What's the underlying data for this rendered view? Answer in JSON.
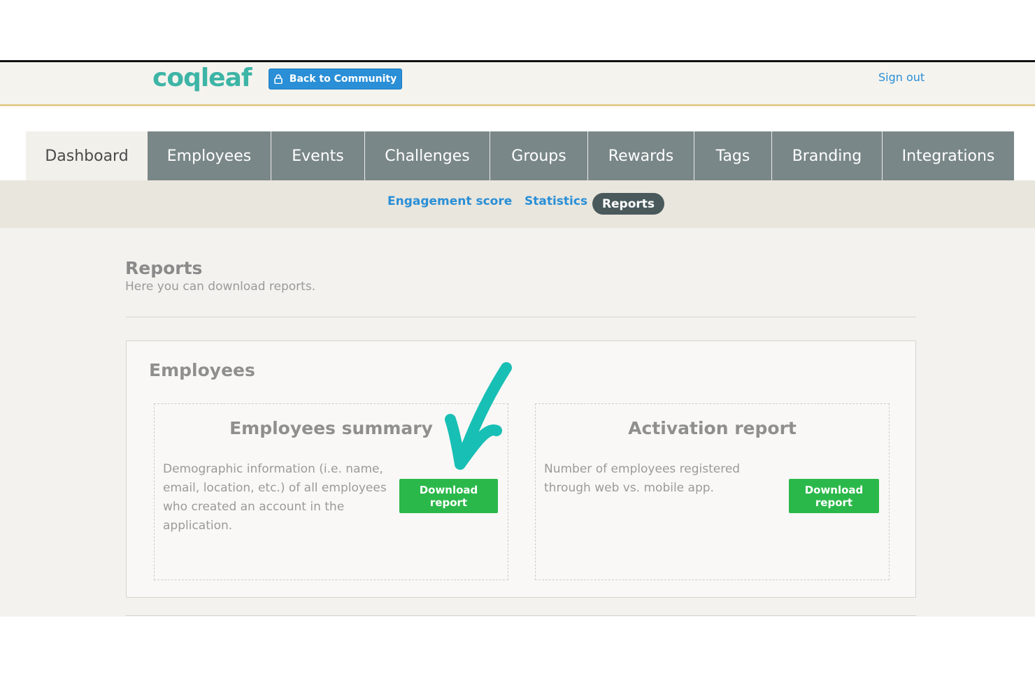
{
  "header": {
    "logo": "coqleaf",
    "back_button": "Back to Community",
    "sign_out": "Sign out"
  },
  "tabs": [
    {
      "label": "Dashboard",
      "active": true
    },
    {
      "label": "Employees"
    },
    {
      "label": "Events"
    },
    {
      "label": "Challenges"
    },
    {
      "label": "Groups"
    },
    {
      "label": "Rewards"
    },
    {
      "label": "Tags"
    },
    {
      "label": "Branding"
    },
    {
      "label": "Integrations"
    }
  ],
  "subnav": {
    "engagement": "Engagement score",
    "statistics": "Statistics",
    "reports": "Reports"
  },
  "page": {
    "title": "Reports",
    "subtitle": "Here you can download reports."
  },
  "panel": {
    "title": "Employees",
    "cards": [
      {
        "title": "Employees summary",
        "lines": [
          "Demographic information (i.e. name,",
          "email, location, etc.) of all employees",
          "who created an account in the",
          "application."
        ],
        "button": [
          "Download",
          "report"
        ]
      },
      {
        "title": "Activation report",
        "lines": [
          "Number of employees registered",
          "through web vs. mobile app."
        ],
        "button": [
          "Download",
          "report"
        ]
      }
    ]
  },
  "colors": {
    "accent_blue": "#2a8fd6",
    "tab_gray": "#7a8788",
    "download_green": "#2bb84a",
    "annotation_teal": "#18bfb5",
    "logo_teal": "#3db5a6"
  },
  "icons": {
    "lock": "lock-icon",
    "annotation": "checkmark-annotation"
  }
}
